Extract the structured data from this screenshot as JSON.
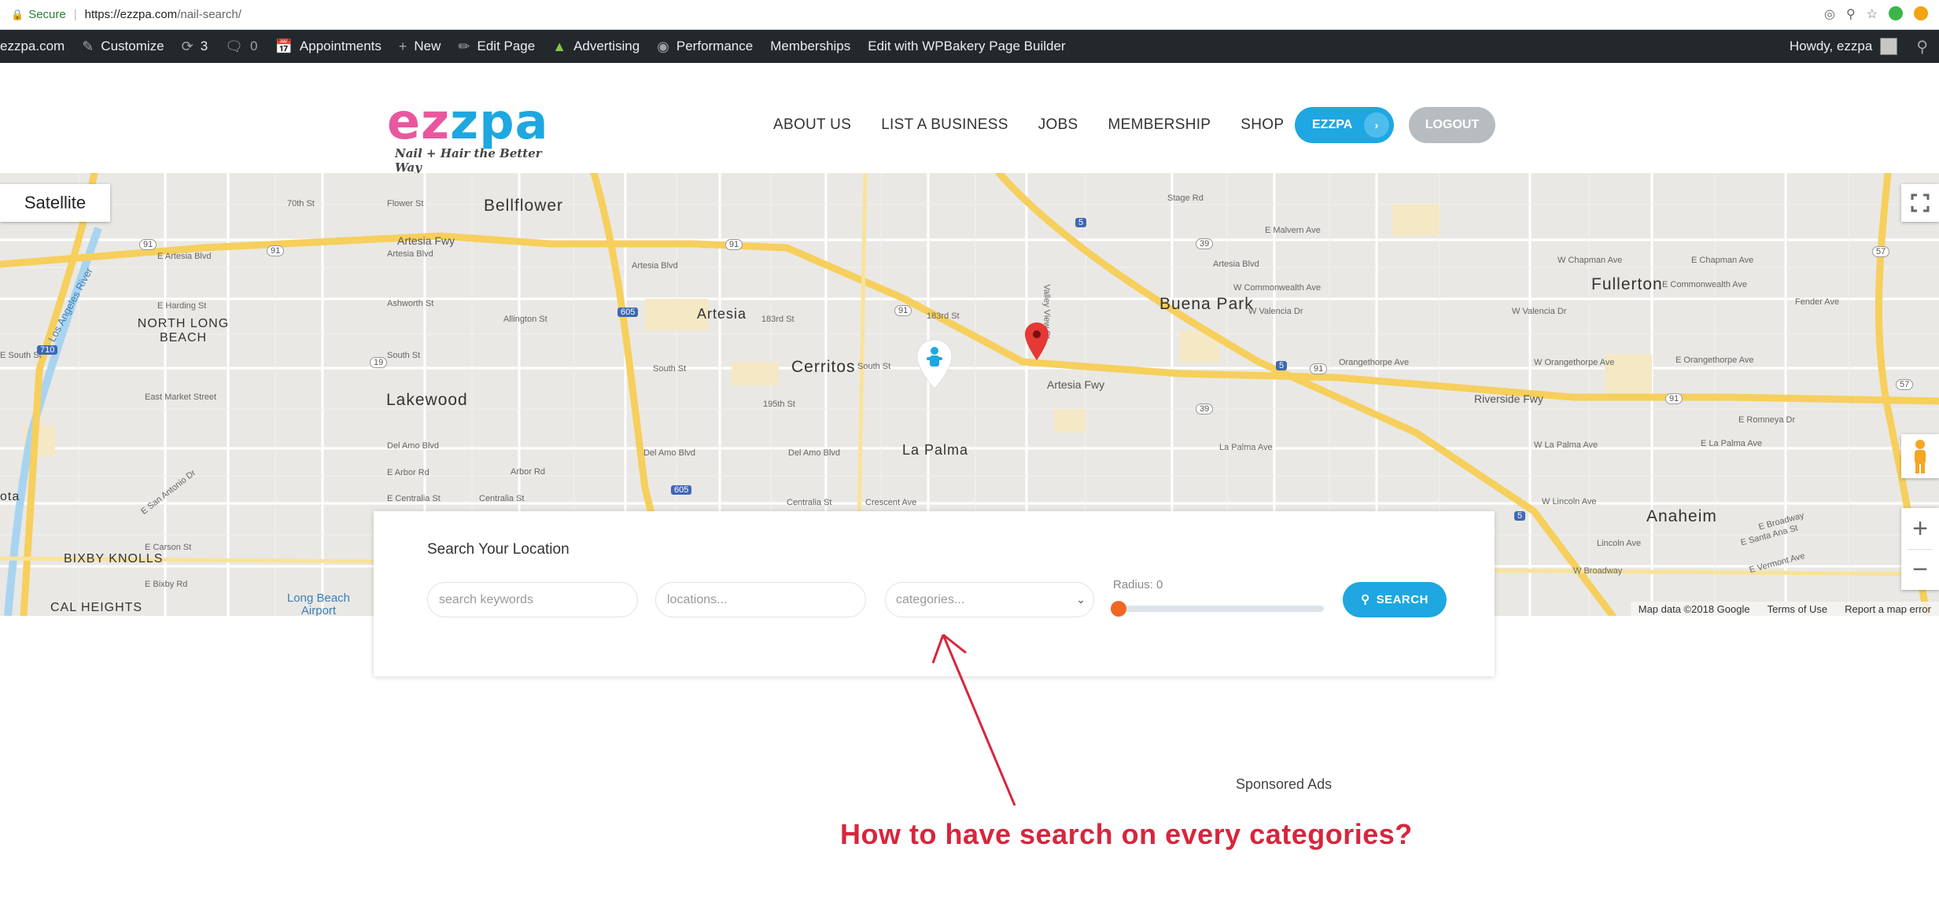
{
  "browser": {
    "secure_label": "Secure",
    "url_host": "https://ezzpa.com",
    "url_path": "/nail-search/"
  },
  "adminbar": {
    "site": "ezzpa.com",
    "customize": "Customize",
    "updates_count": "3",
    "comments_count": "0",
    "appointments": "Appointments",
    "new": "New",
    "edit_page": "Edit Page",
    "advertising": "Advertising",
    "performance": "Performance",
    "memberships": "Memberships",
    "wpbakery": "Edit with WPBakery Page Builder",
    "howdy": "Howdy, ezzpa"
  },
  "header": {
    "logo_text_ez": "ez",
    "logo_text_zpa": "zpa",
    "logo_tagline": "Nail + Hair the Better Way",
    "nav": [
      "ABOUT US",
      "LIST A BUSINESS",
      "JOBS",
      "MEMBERSHIP",
      "SHOP"
    ],
    "ezzpa_button": "EZZPA",
    "logout_button": "LOGOUT"
  },
  "map": {
    "satellite_button": "Satellite",
    "cities": {
      "bellflower": "Bellflower",
      "north_long_beach": "NORTH LONG BEACH",
      "lakewood": "Lakewood",
      "artesia": "Artesia",
      "cerritos": "Cerritos",
      "la_palma": "La Palma",
      "buena_park": "Buena Park",
      "fullerton": "Fullerton",
      "anaheim": "Anaheim",
      "bixby_knolls": "BIXBY KNOLLS",
      "cal_heights": "CAL HEIGHTS",
      "long_beach_airport": "Long Beach Airport",
      "ota": "ota"
    },
    "roads": {
      "artesia_fwy_1": "Artesia Fwy",
      "artesia_fwy_2": "Artesia Fwy",
      "riverside_fwy": "Riverside Fwy",
      "los_angeles_river": "Los Angeles River",
      "e_artesia_blvd": "E Artesia Blvd",
      "artesia_blvd_1": "Artesia Blvd",
      "artesia_blvd_2": "Artesia Blvd",
      "south_st_1": "South St",
      "south_st_2": "South St",
      "south_st_3": "South St",
      "e_south_st": "E South St",
      "del_amo_1": "Del Amo Blvd",
      "del_amo_2": "Del Amo Blvd",
      "del_amo_3": "Del Amo Blvd",
      "centralia_1": "E Centralia St",
      "centralia_2": "Centralia St",
      "crescent": "Crescent Ave",
      "e_market": "East Market Street",
      "e_harding": "E Harding St",
      "ashworth": "Ashworth St",
      "allington": "Allington St",
      "e_carson": "E Carson St",
      "e_bixby": "E Bixby Rd",
      "e_arbor": "E Arbor Rd",
      "arbor_rd": "Arbor Rd",
      "e_san_antonio": "E San Antonio Dr",
      "183rd_1": "183rd St",
      "183rd_2": "183rd St",
      "195th": "195th St",
      "e_malvern": "E Malvern Ave",
      "w_chapman": "W Chapman Ave",
      "e_chapman": "E Chapman Ave",
      "w_commonwealth": "W Commonwealth Ave",
      "e_commonwealth": "E Commonwealth Ave",
      "w_valencia": "W Valencia Dr",
      "fender": "Fender Ave",
      "orangethorpe_1": "Orangethorpe Ave",
      "orangethorpe_2": "E Orangethorpe Ave",
      "w_orangethorpe": "W Orangethorpe Ave",
      "e_romneya": "E Romneya Dr",
      "la_palma_ave": "La Palma Ave",
      "w_la_palma": "W La Palma Ave",
      "e_la_palma": "E La Palma Ave",
      "w_lincoln": "W Lincoln Ave",
      "lincoln": "Lincoln Ave",
      "e_broadway": "E Broadway",
      "w_broadway": "W Broadway",
      "e_santa_ana": "E Santa Ana St",
      "e_vermont": "E Vermont Ave",
      "flower": "Flower St",
      "70th": "70th St",
      "stage": "Stage Rd",
      "valley_view": "Valley View St"
    },
    "highway_shields": [
      "91",
      "91",
      "91",
      "91",
      "91",
      "91",
      "39",
      "39",
      "605",
      "605",
      "710",
      "19",
      "5",
      "5",
      "5",
      "57",
      "57"
    ],
    "footer_data": "Map data ©2018 Google",
    "footer_terms": "Terms of Use",
    "footer_report": "Report a map error"
  },
  "search": {
    "heading": "Search Your Location",
    "keywords_placeholder": "search keywords",
    "locations_placeholder": "locations...",
    "categories_selected": "categories...",
    "radius_label": "Radius: 0",
    "radius_value": 0,
    "search_button": "SEARCH"
  },
  "sponsored": "Sponsored Ads",
  "annotation": "How to have search on every categories?",
  "colors": {
    "brand_pink": "#e9579e",
    "brand_blue": "#1ea7e1",
    "annotation_red": "#d7263d",
    "slider_thumb": "#f26522"
  }
}
